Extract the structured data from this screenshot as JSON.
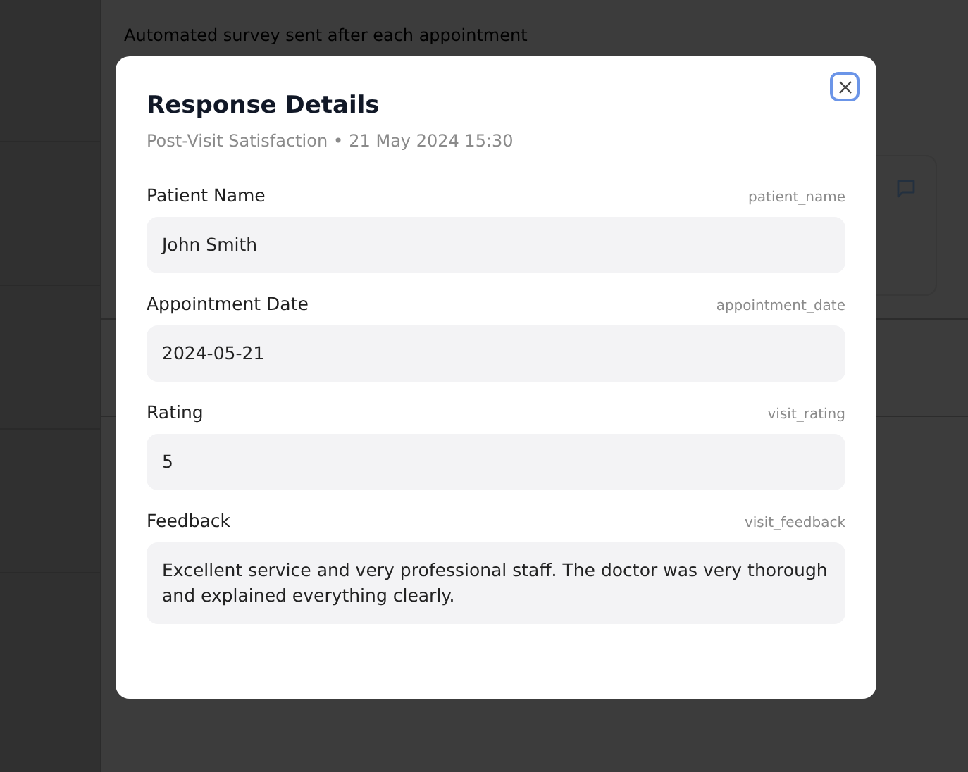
{
  "page": {
    "subtitle": "Automated survey sent after each appointment"
  },
  "modal": {
    "title": "Response Details",
    "survey": "Post-Visit Satisfaction",
    "separator": "•",
    "timestamp": "21 May 2024 15:30",
    "fields": [
      {
        "label": "Patient Name",
        "key": "patient_name",
        "value": "John Smith"
      },
      {
        "label": "Appointment Date",
        "key": "appointment_date",
        "value": "2024-05-21"
      },
      {
        "label": "Rating",
        "key": "visit_rating",
        "value": "5"
      },
      {
        "label": "Feedback",
        "key": "visit_feedback",
        "value": "Excellent service and very professional staff. The doctor was very thorough and explained everything clearly."
      }
    ]
  }
}
